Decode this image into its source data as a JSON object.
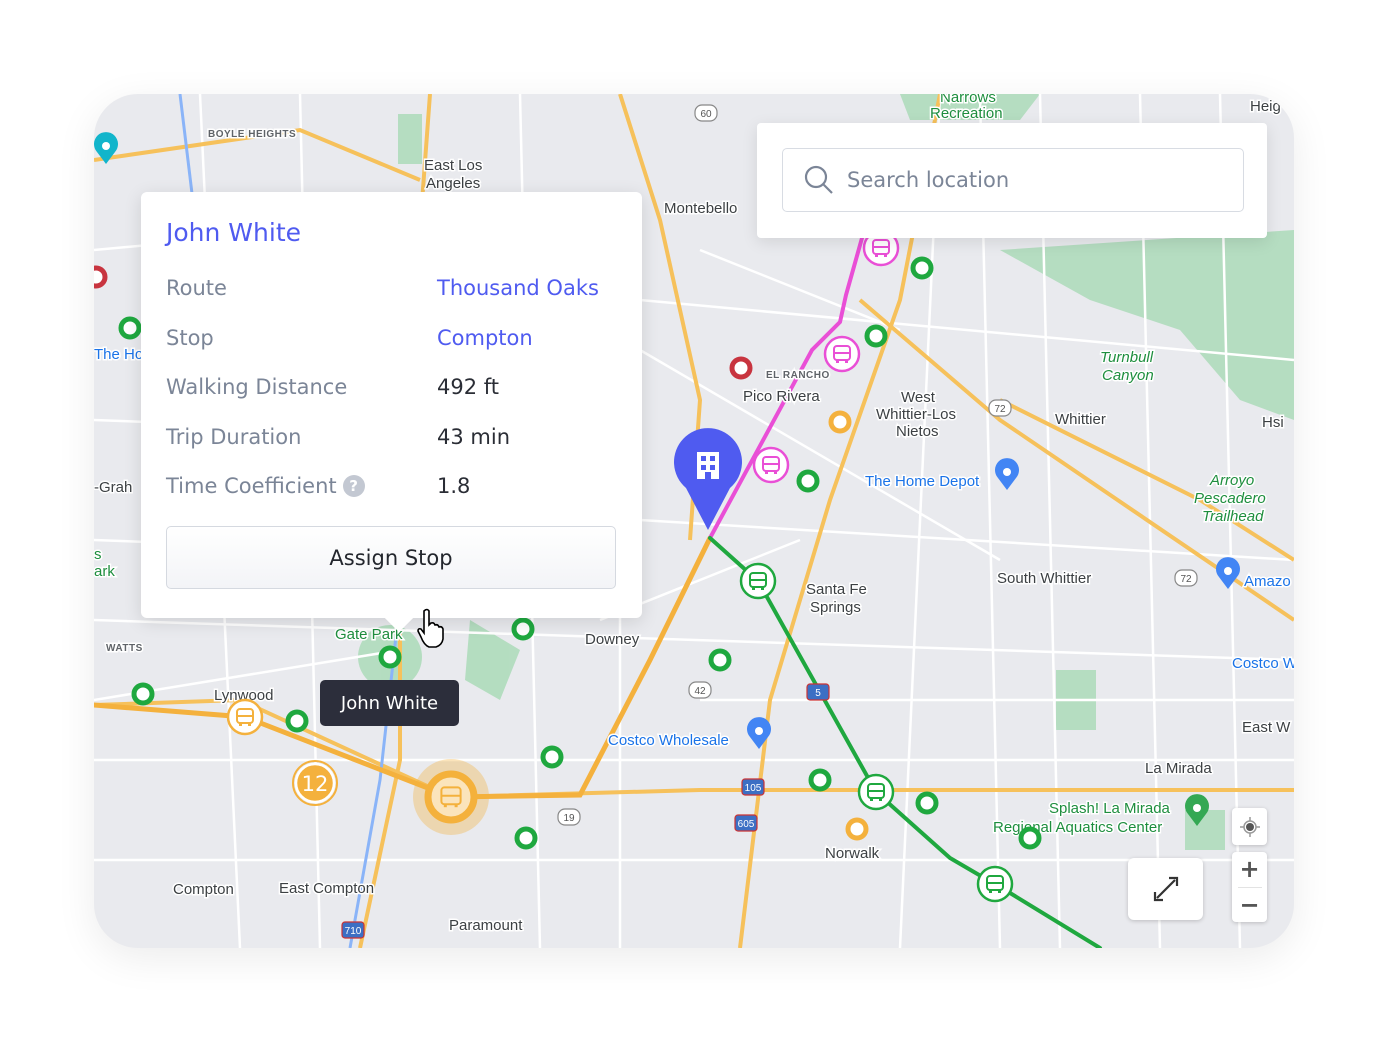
{
  "colors": {
    "accent": "#4f5bf0",
    "route_pink": "#e94fd6",
    "route_green": "#1fa83f",
    "route_orange": "#f4b13d",
    "stop_red": "#c8343f",
    "map_bg": "#e9eaee"
  },
  "popup": {
    "name": "John White",
    "rows": [
      {
        "label": "Route",
        "value": "Thousand Oaks",
        "link": true
      },
      {
        "label": "Stop",
        "value": "Compton",
        "link": true
      },
      {
        "label": "Walking Distance",
        "value": "492 ft",
        "link": false
      },
      {
        "label": "Trip Duration",
        "value": "43 min",
        "link": false
      },
      {
        "label": "Time Coefficient",
        "value": "1.8",
        "link": false,
        "help_icon": "question-circle-icon"
      }
    ],
    "assign_label": "Assign Stop"
  },
  "search": {
    "placeholder": "Search location",
    "icon": "search-icon"
  },
  "tooltip": {
    "text": "John White"
  },
  "cluster": {
    "count": "12"
  },
  "controls": {
    "zoom_in": "+",
    "zoom_out": "−",
    "locate_icon": "crosshair-icon",
    "fullscreen_icon": "expand-icon"
  },
  "map_labels": [
    {
      "t": "BOYLE HEIGHTS",
      "c": "sm"
    },
    {
      "t": "East Los",
      "c": ""
    },
    {
      "t": "Angeles",
      "c": ""
    },
    {
      "t": "Montebello",
      "c": ""
    },
    {
      "t": "Narrows",
      "c": "green"
    },
    {
      "t": "Recreation",
      "c": "green"
    },
    {
      "t": "Heig",
      "c": ""
    },
    {
      "t": "EL RANCHO",
      "c": "sm"
    },
    {
      "t": "Pico Rivera",
      "c": ""
    },
    {
      "t": "West",
      "c": ""
    },
    {
      "t": "Whittier-Los",
      "c": ""
    },
    {
      "t": "Nietos",
      "c": ""
    },
    {
      "t": "Whittier",
      "c": ""
    },
    {
      "t": "Turnbull",
      "c": "green it"
    },
    {
      "t": "Canyon",
      "c": "green it"
    },
    {
      "t": "Hsi",
      "c": ""
    },
    {
      "t": "The Home Depot",
      "c": "blue"
    },
    {
      "t": "Arroyo",
      "c": "green it"
    },
    {
      "t": "Pescadero",
      "c": "green it"
    },
    {
      "t": "Trailhead",
      "c": "green it"
    },
    {
      "t": "South Whittier",
      "c": ""
    },
    {
      "t": "Amazo",
      "c": "blue"
    },
    {
      "t": "Santa Fe",
      "c": ""
    },
    {
      "t": "Springs",
      "c": ""
    },
    {
      "t": "Downey",
      "c": ""
    },
    {
      "t": "Costco W",
      "c": "blue"
    },
    {
      "t": "East W",
      "c": ""
    },
    {
      "t": "Costco Wholesale",
      "c": "blue"
    },
    {
      "t": "La Mirada",
      "c": ""
    },
    {
      "t": "Splash! La Mirada",
      "c": "green"
    },
    {
      "t": "Regional Aquatics Center",
      "c": "green"
    },
    {
      "t": "Norwalk",
      "c": ""
    },
    {
      "t": "Compton",
      "c": ""
    },
    {
      "t": "East Compton",
      "c": ""
    },
    {
      "t": "Paramount",
      "c": ""
    },
    {
      "t": "Lynwood",
      "c": ""
    },
    {
      "t": "WATTS",
      "c": "sm"
    },
    {
      "t": "Gate Park",
      "c": "green"
    },
    {
      "t": "-Grah",
      "c": ""
    },
    {
      "t": "The Ho",
      "c": "blue"
    },
    {
      "t": "s",
      "c": "green"
    },
    {
      "t": "ark",
      "c": "green"
    }
  ],
  "shields": [
    "60",
    "72",
    "72",
    "42",
    "19",
    "105",
    "605",
    "710",
    "5"
  ]
}
